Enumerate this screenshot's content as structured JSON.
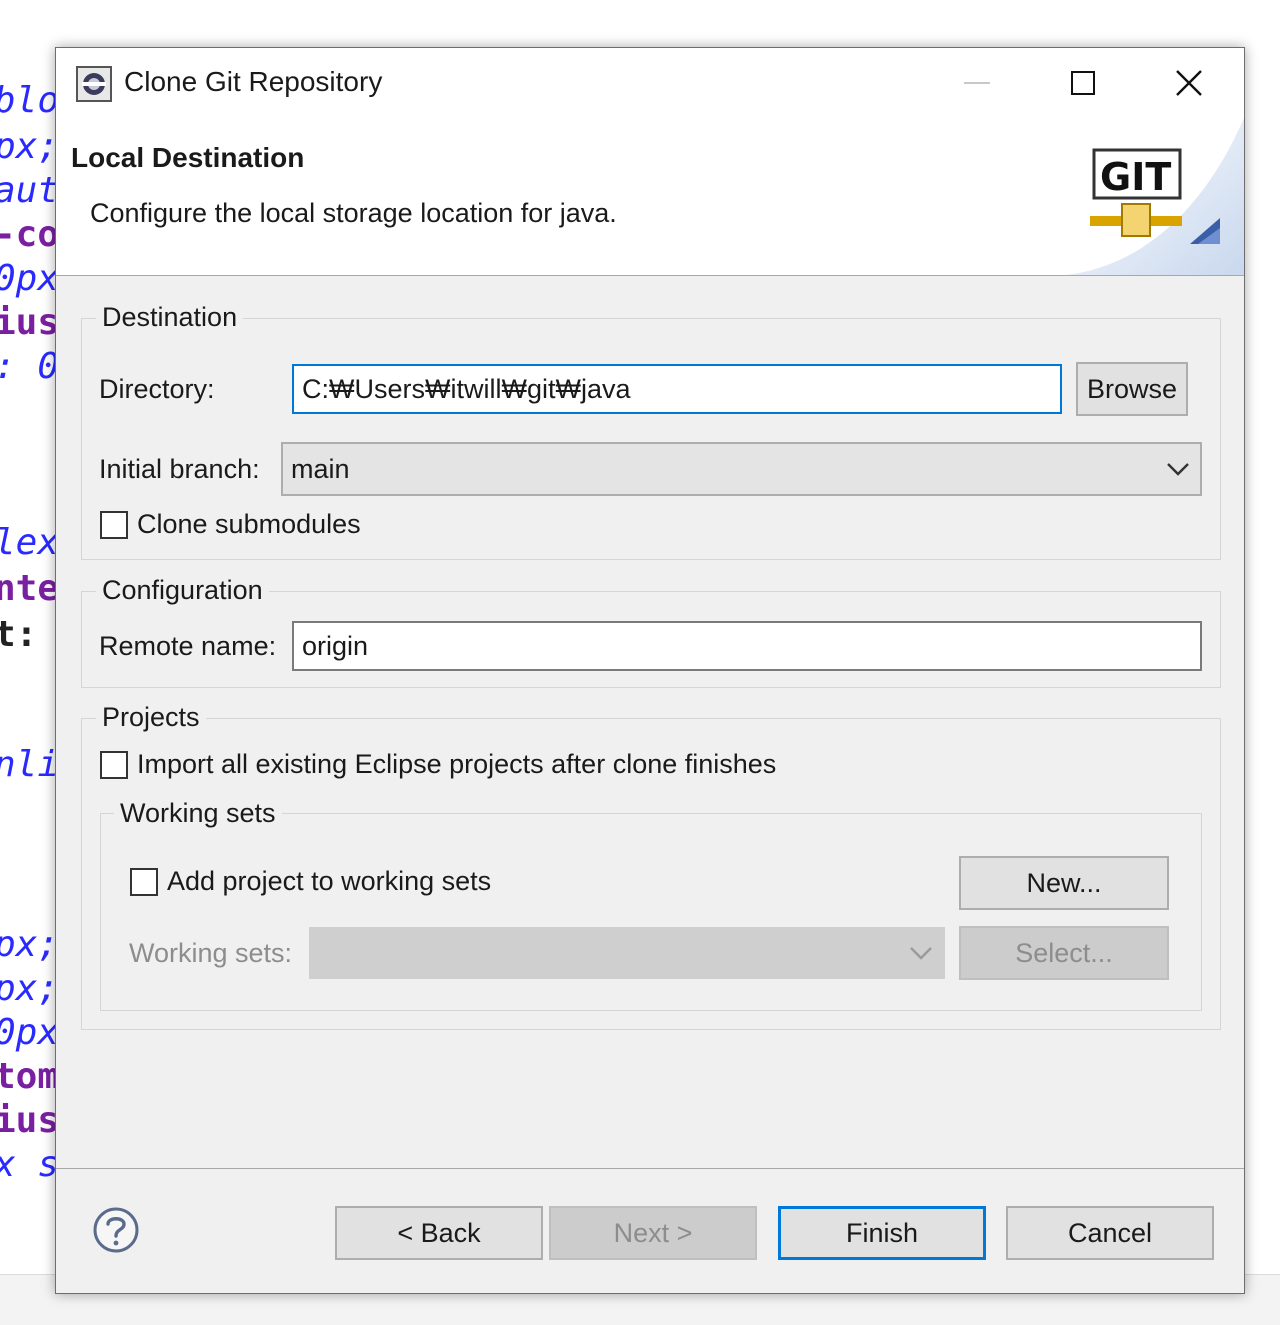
{
  "background_code": [
    "blo",
    "px;",
    "aut",
    "-co",
    "0px",
    "ius",
    ": 0",
    "lex",
    "nte",
    "t: ",
    "nli",
    "px;",
    "px;",
    "0px",
    "tom",
    "ius",
    "x s"
  ],
  "window": {
    "title": "Clone Git Repository",
    "controls": {
      "minimize": "minimize-icon",
      "maximize": "maximize-icon",
      "close": "close-icon"
    }
  },
  "header": {
    "title": "Local Destination",
    "description": "Configure the local storage location for java.",
    "logo_text": "GIT"
  },
  "destination": {
    "legend": "Destination",
    "directory_label": "Directory:",
    "directory_value": "C:₩Users₩itwill₩git₩java",
    "browse_label": "Browse",
    "initial_branch_label": "Initial branch:",
    "initial_branch_value": "main",
    "clone_submodules_label": "Clone submodules",
    "clone_submodules_checked": false
  },
  "configuration": {
    "legend": "Configuration",
    "remote_name_label": "Remote name:",
    "remote_name_value": "origin"
  },
  "projects": {
    "legend": "Projects",
    "import_label": "Import all existing Eclipse projects after clone finishes",
    "import_checked": false,
    "working_sets": {
      "legend": "Working sets",
      "add_label": "Add project to working sets",
      "add_checked": false,
      "new_label": "New...",
      "working_sets_label": "Working sets:",
      "working_sets_value": "",
      "select_label": "Select..."
    }
  },
  "footer": {
    "help_icon": "help-icon",
    "back_label": "< Back",
    "next_label": "Next >",
    "finish_label": "Finish",
    "cancel_label": "Cancel"
  },
  "colors": {
    "focus_border": "#0078d7",
    "dialog_bg": "#f0f0f0",
    "code_purple": "#7a1fa2",
    "code_blue": "#2a2aff"
  }
}
